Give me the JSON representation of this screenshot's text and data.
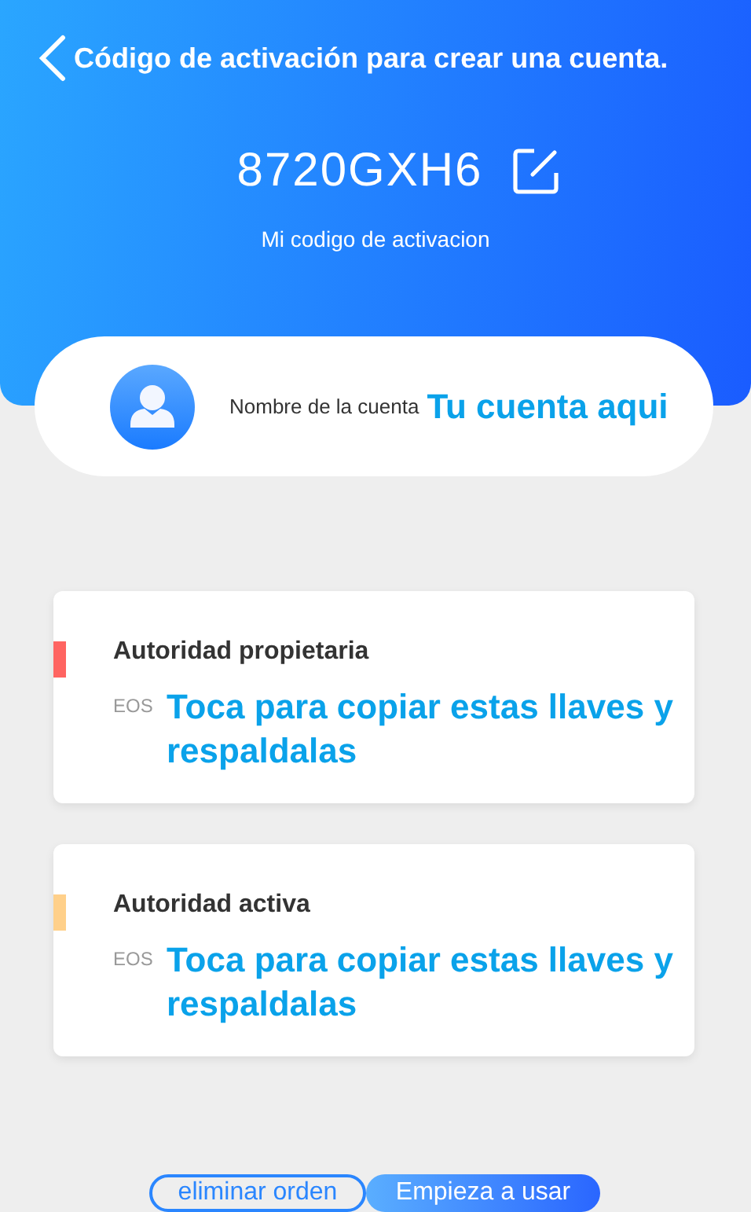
{
  "header": {
    "title": "Código de activación para crear una cuenta.",
    "code": "8720GXH6",
    "code_label": "Mi codigo de activacion"
  },
  "account": {
    "label": "Nombre de la cuenta",
    "value": "Tu cuenta aqui"
  },
  "authorities": [
    {
      "title": "Autoridad propietaria",
      "color": "#ff6461",
      "key_prefix": "EOS",
      "hint": "Toca para copiar estas llaves y respaldalas"
    },
    {
      "title": "Autoridad activa",
      "color": "#ffd08a",
      "key_prefix": "EOS",
      "hint": "Toca para copiar estas llaves y respaldalas"
    }
  ],
  "buttons": [
    {
      "label": "eliminar orden",
      "kind": "outline"
    },
    {
      "label": "Empieza a usar",
      "kind": "filled"
    }
  ]
}
